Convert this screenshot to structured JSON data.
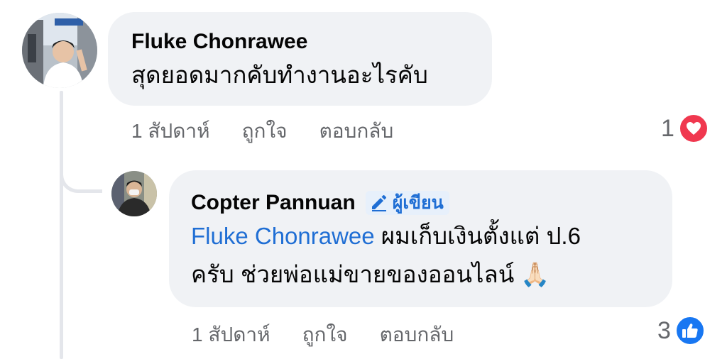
{
  "comments": [
    {
      "author": "Fluke Chonrawee",
      "text": "สุดยอดมากคับทำงานอะไรคับ",
      "time": "1 สัปดาห์",
      "like_label": "ถูกใจ",
      "reply_label": "ตอบกลับ",
      "reaction_count": "1",
      "reaction_icon": "love-heart-icon",
      "reaction_color": "#f0384f"
    },
    {
      "author": "Copter Pannuan",
      "badge": "ผู้เขียน",
      "mention": "Fluke Chonrawee",
      "text_line1": " ผมเก็บเงินตั้งแต่ ป.6",
      "text_line2": "ครับ ช่วยพ่อแม่ขายของออนไลน์ 🙏🏻",
      "time": "1 สัปดาห์",
      "like_label": "ถูกใจ",
      "reply_label": "ตอบกลับ",
      "reaction_count": "3",
      "reaction_icon": "like-thumb-icon",
      "reaction_color": "#1877f2"
    }
  ],
  "colors": {
    "bubble": "#f0f2f5",
    "mention": "#1f6ed4",
    "meta_text": "#65676b"
  }
}
